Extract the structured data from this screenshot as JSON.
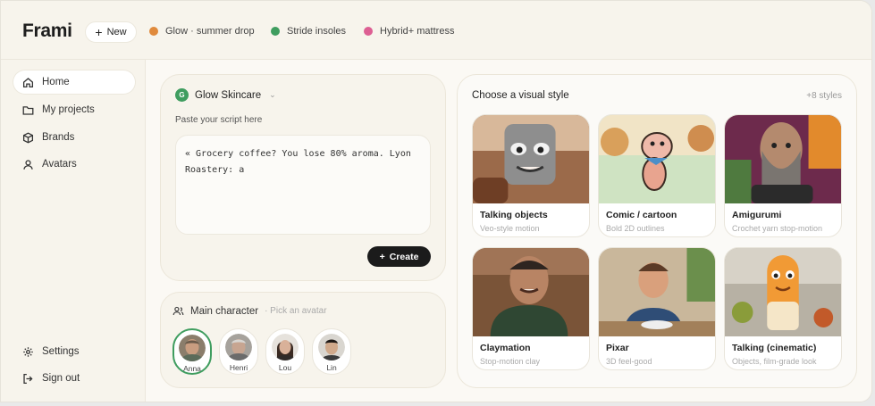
{
  "app": {
    "name": "Frami"
  },
  "header": {
    "new_label": "New",
    "projects": [
      {
        "label": "Glow · summer drop",
        "color": "#e08a3c"
      },
      {
        "label": "Stride insoles",
        "color": "#3f9d5f"
      },
      {
        "label": "Hybrid+ mattress",
        "color": "#dd5f93"
      }
    ]
  },
  "sidebar": {
    "items": [
      {
        "label": "Home",
        "icon": "home-icon",
        "active": true
      },
      {
        "label": "My projects",
        "icon": "folder-icon"
      },
      {
        "label": "Brands",
        "icon": "box-icon"
      },
      {
        "label": "Avatars",
        "icon": "user-icon"
      }
    ],
    "bottom": [
      {
        "label": "Settings",
        "icon": "gear-icon"
      },
      {
        "label": "Sign out",
        "icon": "sign-out-icon"
      }
    ]
  },
  "script_panel": {
    "brand_initial": "G",
    "brand_name": "Glow Skincare",
    "script_label": "Paste your script here",
    "script_text": "« Grocery coffee? You lose 80% aroma. Lyon Roastery: a",
    "create_label": "Create"
  },
  "character_panel": {
    "title": "Main character",
    "subtitle": "· Pick an avatar",
    "avatars": [
      {
        "name": "Anna",
        "selected": true
      },
      {
        "name": "Henri"
      },
      {
        "name": "Lou"
      },
      {
        "name": "Lin"
      }
    ]
  },
  "styles_panel": {
    "title": "Choose a visual style",
    "more": "+8 styles",
    "styles": [
      {
        "name": "Talking objects",
        "desc": "Veo-style motion"
      },
      {
        "name": "Comic / cartoon",
        "desc": "Bold 2D outlines"
      },
      {
        "name": "Amigurumi",
        "desc": "Crochet yarn stop-motion"
      },
      {
        "name": "Claymation",
        "desc": "Stop-motion clay"
      },
      {
        "name": "Pixar",
        "desc": "3D feel-good"
      },
      {
        "name": "Talking (cinematic)",
        "desc": "Objects, film-grade look"
      }
    ]
  }
}
